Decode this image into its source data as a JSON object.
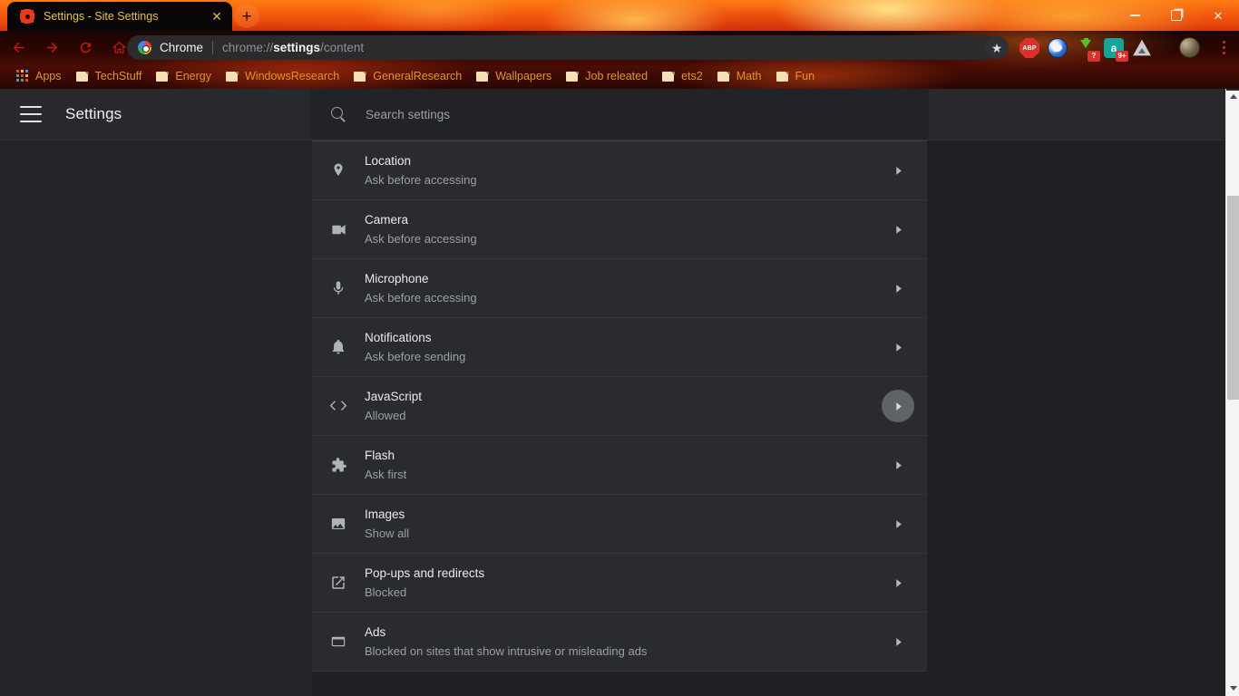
{
  "window": {
    "controls": {
      "minimize": "minimize-button",
      "maximize": "restore-button",
      "close": "✕"
    }
  },
  "tabstrip": {
    "active_tab": {
      "title": "Settings - Site Settings",
      "favicon": "settings-gear-icon",
      "close_label": "✕"
    },
    "new_tab_label": "+"
  },
  "toolbar": {
    "back_label": "back-icon",
    "forward_label": "forward-icon",
    "reload_label": "reload-icon",
    "home_label": "home-icon",
    "omnibox": {
      "chrome_label": "Chrome",
      "url_scheme": "chrome://",
      "url_bold": "settings",
      "url_tail": "/content"
    },
    "bookmark_star": "★",
    "extensions": [
      {
        "name": "adblock-plus-extension",
        "label": "ABP",
        "badge": ""
      },
      {
        "name": "bird-extension",
        "label": "",
        "badge": ""
      },
      {
        "name": "download-manager-extension",
        "label": "",
        "badge": "?"
      },
      {
        "name": "a-extension",
        "label": "a",
        "badge": "9+"
      },
      {
        "name": "drive-extension",
        "label": "",
        "badge": ""
      }
    ],
    "avatar_label": "profile-avatar",
    "menu_label": "chrome-menu"
  },
  "bookmarks": [
    {
      "label": "Apps",
      "icon": "apps-grid-icon"
    },
    {
      "label": "TechStuff",
      "icon": "folder-icon"
    },
    {
      "label": "Energy",
      "icon": "folder-icon"
    },
    {
      "label": "WindowsResearch",
      "icon": "folder-icon"
    },
    {
      "label": "GeneralResearch",
      "icon": "folder-icon"
    },
    {
      "label": "Wallpapers",
      "icon": "folder-icon"
    },
    {
      "label": "Job releated",
      "icon": "folder-icon"
    },
    {
      "label": "ets2",
      "icon": "folder-icon"
    },
    {
      "label": "Math",
      "icon": "folder-icon"
    },
    {
      "label": "Fun",
      "icon": "folder-icon"
    }
  ],
  "settings": {
    "title": "Settings",
    "menu_icon": "hamburger-menu-icon",
    "search": {
      "placeholder": "Search settings",
      "value": "",
      "icon": "search-icon"
    },
    "content_rows": [
      {
        "icon": "location-pin-icon",
        "title": "Location",
        "sub": "Ask before accessing",
        "hovered": false
      },
      {
        "icon": "camera-icon",
        "title": "Camera",
        "sub": "Ask before accessing",
        "hovered": false
      },
      {
        "icon": "microphone-icon",
        "title": "Microphone",
        "sub": "Ask before accessing",
        "hovered": false
      },
      {
        "icon": "bell-icon",
        "title": "Notifications",
        "sub": "Ask before sending",
        "hovered": false
      },
      {
        "icon": "code-brackets-icon",
        "title": "JavaScript",
        "sub": "Allowed",
        "hovered": true
      },
      {
        "icon": "puzzle-piece-icon",
        "title": "Flash",
        "sub": "Ask first",
        "hovered": false
      },
      {
        "icon": "image-icon",
        "title": "Images",
        "sub": "Show all",
        "hovered": false
      },
      {
        "icon": "external-link-icon",
        "title": "Pop-ups and redirects",
        "sub": "Blocked",
        "hovered": false
      },
      {
        "icon": "ad-box-icon",
        "title": "Ads",
        "sub": "Blocked on sites that show intrusive or misleading ads",
        "hovered": false
      }
    ]
  },
  "scrollbar": {
    "up_label": "scroll-up",
    "down_label": "scroll-down"
  },
  "colors": {
    "accent_orange": "#e0952d",
    "tab_title": "#e8c24a",
    "page_bg": "#202124",
    "card_bg": "#292b2e",
    "text_primary": "#e8eaed",
    "text_secondary": "#9aa0a6"
  }
}
